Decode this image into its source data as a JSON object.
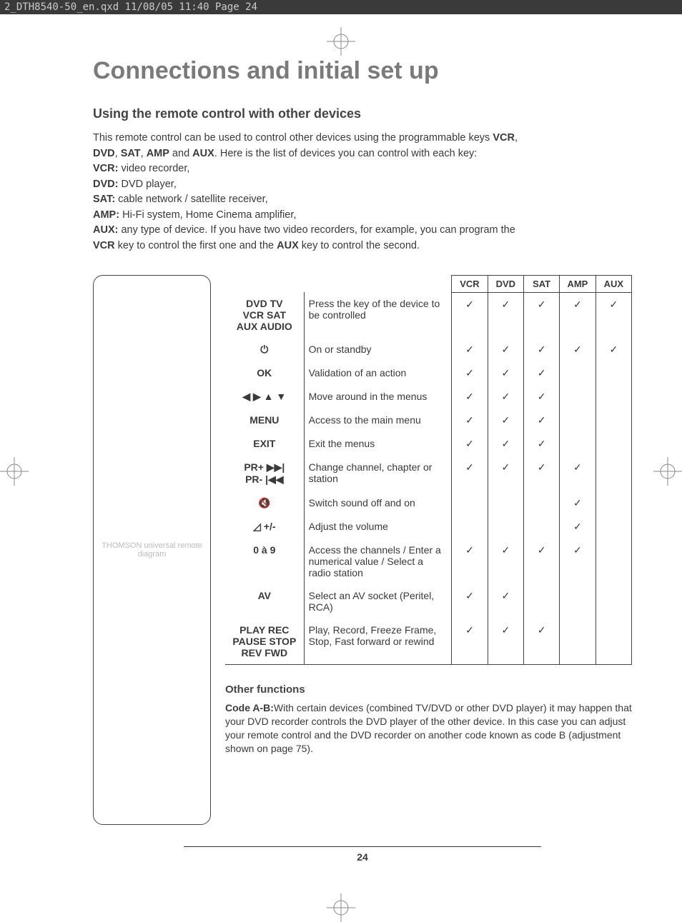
{
  "header_bar": "2_DTH8540-50_en.qxd  11/08/05  11:40  Page 24",
  "title": "Connections and initial set up",
  "subtitle": "Using the remote control with other devices",
  "intro": {
    "line1_a": "This remote control can be used to control other devices using the programmable keys ",
    "line1_b": "VCR",
    "line1_c": ",",
    "line2_a": "DVD",
    "line2_b": ", ",
    "line2_c": "SAT",
    "line2_d": ", ",
    "line2_e": "AMP",
    "line2_f": " and ",
    "line2_g": "AUX",
    "line2_h": ". Here is the list of devices you can control with each key:",
    "key_vcr": "VCR:",
    "val_vcr": " video recorder,",
    "key_dvd": "DVD:",
    "val_dvd": " DVD player,",
    "key_sat": "SAT:",
    "val_sat": " cable network / satellite receiver,",
    "key_amp": "AMP:",
    "val_amp": " Hi-Fi system, Home Cinema amplifier,",
    "key_aux": "AUX:",
    "val_aux_a": " any type of device. If you have two video recorders, for example, you can program the",
    "val_aux_b": "VCR",
    "val_aux_c": " key to control the first one and the ",
    "val_aux_d": "AUX",
    "val_aux_e": " key to control the second."
  },
  "table": {
    "headers": [
      "VCR",
      "DVD",
      "SAT",
      "AMP",
      "AUX"
    ],
    "rows": [
      {
        "key": "DVD TV\nVCR SAT\nAUX AUDIO",
        "desc": "Press the key of the device to be controlled",
        "cells": [
          "✓",
          "✓",
          "✓",
          "✓",
          "✓"
        ]
      },
      {
        "key": "⏻",
        "desc": "On or standby",
        "cells": [
          "✓",
          "✓",
          "✓",
          "✓",
          "✓"
        ]
      },
      {
        "key": "OK",
        "desc": "Validation of an action",
        "cells": [
          "✓",
          "✓",
          "✓",
          "",
          ""
        ]
      },
      {
        "key": "◀ ▶ ▲ ▼",
        "desc": "Move around in the menus",
        "cells": [
          "✓",
          "✓",
          "✓",
          "",
          ""
        ]
      },
      {
        "key": "MENU",
        "desc": "Access to the main menu",
        "cells": [
          "✓",
          "✓",
          "✓",
          "",
          ""
        ]
      },
      {
        "key": "EXIT",
        "desc": "Exit the menus",
        "cells": [
          "✓",
          "✓",
          "✓",
          "",
          ""
        ]
      },
      {
        "key": "PR+ ▶▶|\nPR- |◀◀",
        "desc": "Change channel, chapter or station",
        "cells": [
          "✓",
          "✓",
          "✓",
          "✓",
          ""
        ]
      },
      {
        "key": "🔇",
        "desc": "Switch sound off and on",
        "cells": [
          "",
          "",
          "",
          "✓",
          ""
        ]
      },
      {
        "key": "◿ +/-",
        "desc": "Adjust the volume",
        "cells": [
          "",
          "",
          "",
          "✓",
          ""
        ]
      },
      {
        "key": "0 à 9",
        "desc": "Access the channels / Enter a numerical value / Select a radio station",
        "cells": [
          "✓",
          "✓",
          "✓",
          "✓",
          ""
        ]
      },
      {
        "key": "AV",
        "desc": "Select an AV socket (Peritel, RCA)",
        "cells": [
          "✓",
          "✓",
          "",
          "",
          ""
        ]
      },
      {
        "key": "PLAY REC\nPAUSE STOP\nREV FWD",
        "desc": "Play, Record, Freeze Frame, Stop, Fast forward or rewind",
        "cells": [
          "✓",
          "✓",
          "✓",
          "",
          ""
        ]
      }
    ]
  },
  "other": {
    "heading": "Other functions",
    "body_a": "Code A-B:",
    "body_b": "With certain devices (combined TV/DVD or other DVD player) it may happen that your DVD recorder controls the DVD player of the other device. In this case you can adjust your remote control and the DVD recorder on another code known as code B (adjustment shown on page 75)."
  },
  "page_number": "24",
  "remote_placeholder": "THOMSON universal remote diagram"
}
